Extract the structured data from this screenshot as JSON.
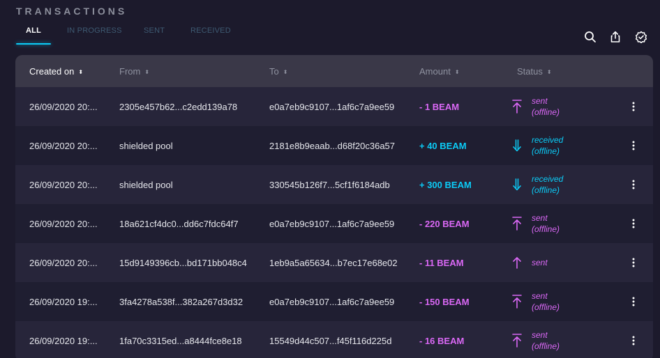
{
  "page": {
    "title": "TRANSACTIONS"
  },
  "tabs": [
    {
      "label": "ALL",
      "active": true
    },
    {
      "label": "IN PROGRESS",
      "active": false
    },
    {
      "label": "SENT",
      "active": false
    },
    {
      "label": "RECEIVED",
      "active": false
    }
  ],
  "toolbar": {
    "icons": [
      "search-icon",
      "export-icon",
      "proof-icon"
    ]
  },
  "colors": {
    "accent": "#0bccf7",
    "sent": "#da68f5",
    "received": "#0bccf7",
    "background": "#1c1a2c",
    "header": "#3a3848"
  },
  "table": {
    "columns": [
      {
        "label": "Created on",
        "sort_icon": "⬍"
      },
      {
        "label": "From",
        "sort_icon": "⬍"
      },
      {
        "label": "To",
        "sort_icon": "⬍"
      },
      {
        "label": "Amount",
        "sort_icon": "⬍"
      },
      {
        "label": "Status",
        "sort_icon": "⬍"
      }
    ],
    "rows": [
      {
        "date": "26/09/2020 20:...",
        "from": "2305e457b62...c2edd139a78",
        "to": "e0a7eb9c9107...1af6c7a9ee59",
        "amount": "- 1 BEAM",
        "direction": "sent",
        "icon": "sent-offline-icon",
        "status_line1": "sent",
        "status_line2": "(offline)"
      },
      {
        "date": "26/09/2020 20:...",
        "from": "shielded pool",
        "to": "2181e8b9eaab...d68f20c36a57",
        "amount": "+ 40 BEAM",
        "direction": "received",
        "icon": "received-offline-icon",
        "status_line1": "received",
        "status_line2": "(offline)"
      },
      {
        "date": "26/09/2020 20:...",
        "from": "shielded pool",
        "to": "330545b126f7...5cf1f6184adb",
        "amount": "+ 300 BEAM",
        "direction": "received",
        "icon": "received-offline-icon",
        "status_line1": "received",
        "status_line2": "(offline)"
      },
      {
        "date": "26/09/2020 20:...",
        "from": "18a621cf4dc0...dd6c7fdc64f7",
        "to": "e0a7eb9c9107...1af6c7a9ee59",
        "amount": "- 220 BEAM",
        "direction": "sent",
        "icon": "sent-offline-icon",
        "status_line1": "sent",
        "status_line2": "(offline)"
      },
      {
        "date": "26/09/2020 20:...",
        "from": "15d9149396cb...bd171bb048c4",
        "to": "1eb9a5a65634...b7ec17e68e02",
        "amount": "- 11 BEAM",
        "direction": "sent",
        "icon": "sent-icon",
        "status_line1": "sent",
        "status_line2": ""
      },
      {
        "date": "26/09/2020 19:...",
        "from": "3fa4278a538f...382a267d3d32",
        "to": "e0a7eb9c9107...1af6c7a9ee59",
        "amount": "- 150 BEAM",
        "direction": "sent",
        "icon": "sent-offline-icon",
        "status_line1": "sent",
        "status_line2": "(offline)"
      },
      {
        "date": "26/09/2020 19:...",
        "from": "1fa70c3315ed...a8444fce8e18",
        "to": "15549d44c507...f45f116d225d",
        "amount": "- 16 BEAM",
        "direction": "sent",
        "icon": "sent-offline-icon",
        "status_line1": "sent",
        "status_line2": "(offline)"
      }
    ]
  }
}
